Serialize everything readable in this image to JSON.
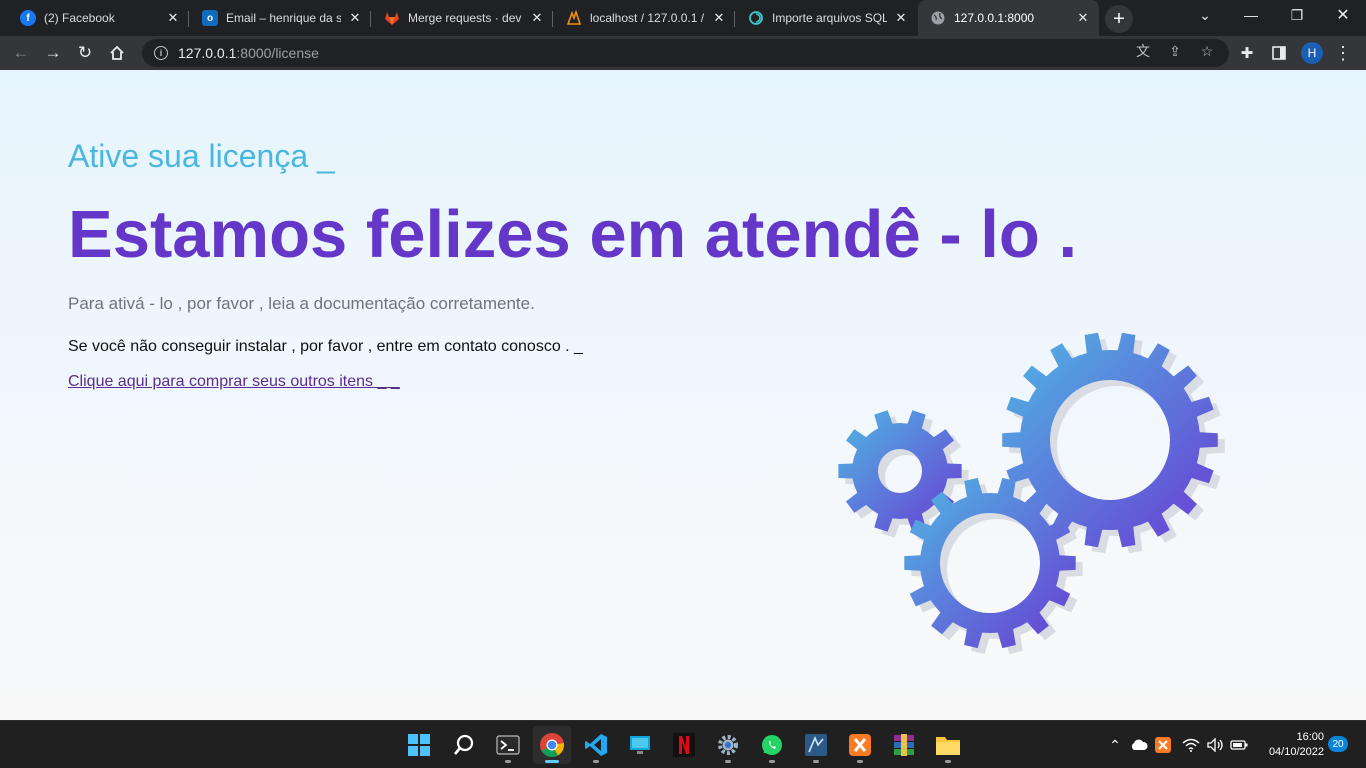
{
  "browser": {
    "tabs": [
      {
        "title": "(2) Facebook",
        "icon": "facebook-icon",
        "color": "#1877f2",
        "glyph": "f"
      },
      {
        "title": "Email – henrique da silva",
        "icon": "outlook-icon",
        "color": "#0f6cbd",
        "glyph": "o"
      },
      {
        "title": "Merge requests · dev / …",
        "icon": "gitlab-icon",
        "color": "#e24329",
        "glyph": ""
      },
      {
        "title": "localhost / 127.0.0.1 / …",
        "icon": "phpmyadmin-icon",
        "color": "#f29111",
        "glyph": ""
      },
      {
        "title": "Importe arquivos SQL …",
        "icon": "swirl-icon",
        "color": "#20b2aa",
        "glyph": ""
      },
      {
        "title": "127.0.0.1:8000",
        "icon": "globe-icon",
        "color": "#9aa0a6",
        "glyph": ""
      }
    ],
    "url_host": "127.0.0.1",
    "url_path": ":8000/license",
    "profile_initial": "H"
  },
  "page": {
    "subtitle": "Ative sua licença _",
    "headline": "Estamos felizes em atendê - lo .",
    "para1": "Para ativá - lo , por favor , leia a documentação corretamente.",
    "para2": "Se você não conseguir instalar , por favor , entre em contato conosco . _",
    "link": "Clique aqui para comprar seus outros itens _ _",
    "gradient_colors": [
      "#4fb8e4",
      "#6a3bd2"
    ]
  },
  "taskbar": {
    "apps": [
      "start-icon",
      "search-icon",
      "terminal-icon",
      "chrome-icon",
      "vscode-icon",
      "remote-desktop-icon",
      "netflix-icon",
      "settings-icon",
      "whatsapp-icon",
      "mysql-workbench-icon",
      "xampp-icon",
      "winrar-icon",
      "file-explorer-icon"
    ],
    "time": "16:00",
    "date": "04/10/2022",
    "notifications": "20"
  }
}
